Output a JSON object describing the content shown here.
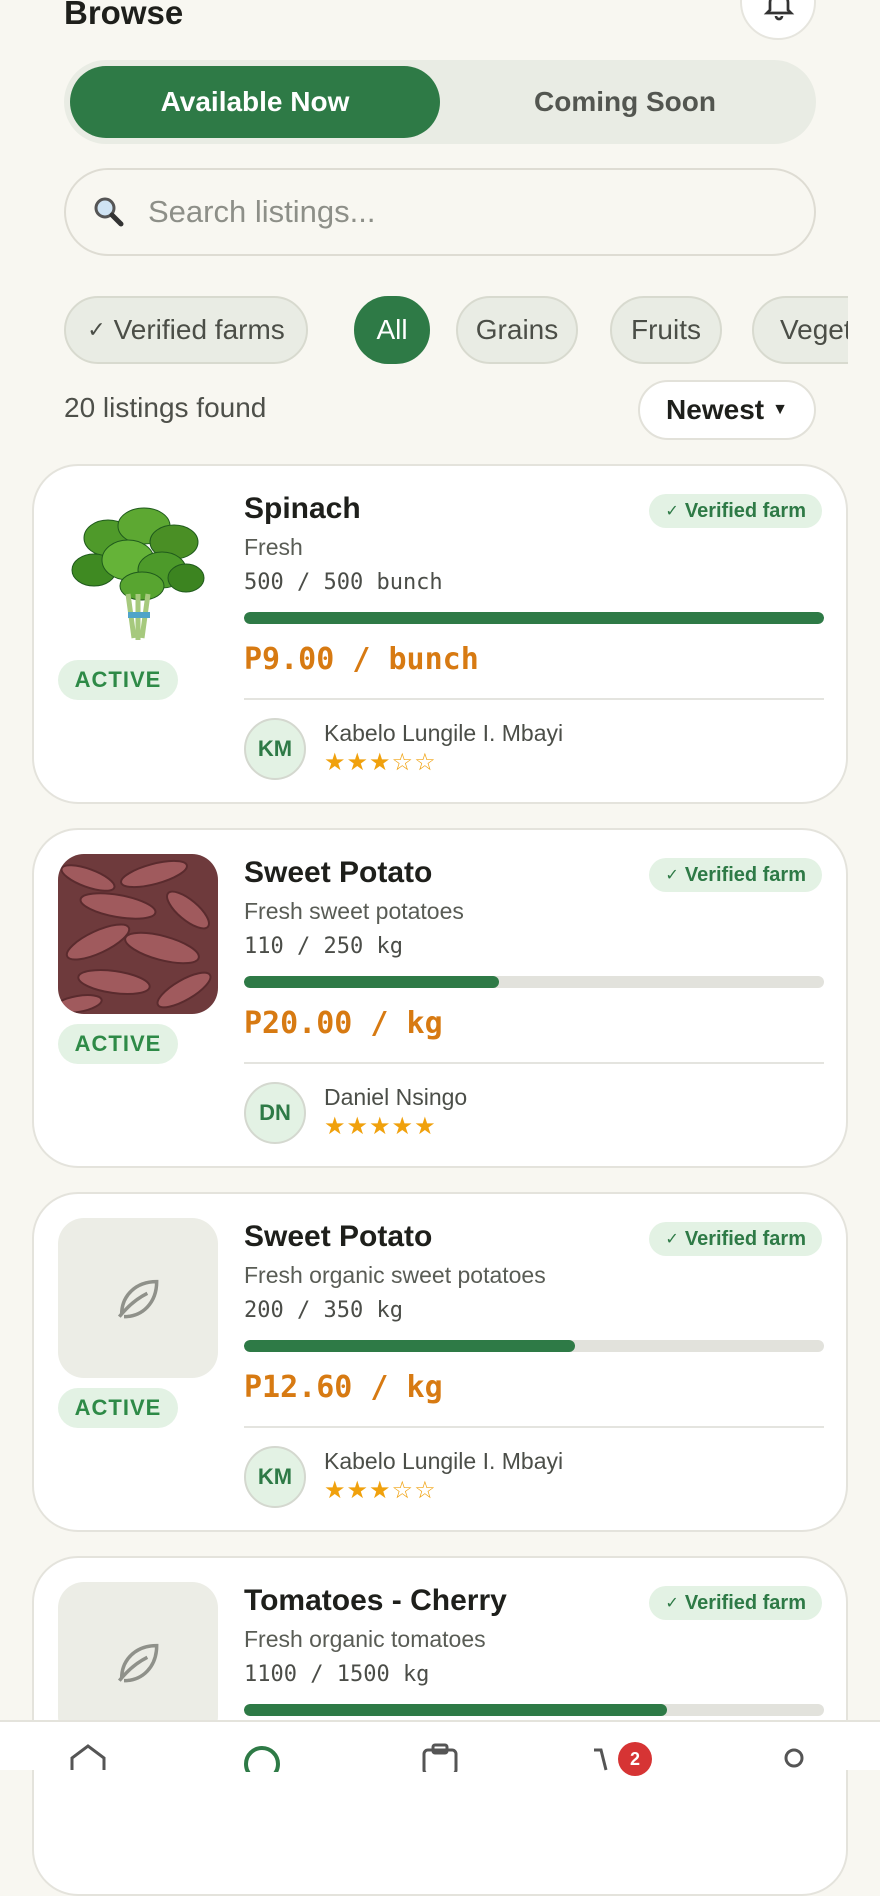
{
  "header": {
    "title": "Browse"
  },
  "segments": {
    "available": "Available Now",
    "coming": "Coming Soon"
  },
  "search": {
    "placeholder": "Search listings..."
  },
  "filters": [
    "Verified farms",
    "All",
    "Grains",
    "Fruits",
    "Vegetables"
  ],
  "results": {
    "count_text": "20 listings found",
    "sort_label": "Newest"
  },
  "colors": {
    "primary": "#2e7a46",
    "price": "#d77a12",
    "star": "#f0a10d",
    "badge_bg": "#e3f2e4",
    "alert": "#d63434"
  },
  "listings": [
    {
      "name": "Spinach",
      "desc": "Fresh",
      "qty": "500 / 500 bunch",
      "progress": 1.0,
      "price": "P9.00 / bunch",
      "status": "ACTIVE",
      "verified": "Verified farm",
      "initials": "KM",
      "farmer": "Kabelo Lungile I. Mbayi",
      "rating": 3,
      "image": "spinach"
    },
    {
      "name": "Sweet Potato",
      "desc": "Fresh sweet potatoes",
      "qty": "110 / 250 kg",
      "progress": 0.44,
      "price": "P20.00 / kg",
      "status": "ACTIVE",
      "verified": "Verified farm",
      "initials": "DN",
      "farmer": "Daniel Nsingo",
      "rating": 5,
      "image": "sweet-potato"
    },
    {
      "name": "Sweet Potato",
      "desc": "Fresh organic sweet potatoes",
      "qty": "200 / 350 kg",
      "progress": 0.57,
      "price": "P12.60 / kg",
      "status": "ACTIVE",
      "verified": "Verified farm",
      "initials": "KM",
      "farmer": "Kabelo Lungile I. Mbayi",
      "rating": 3,
      "image": "leaf-placeholder"
    },
    {
      "name": "Tomatoes - Cherry",
      "desc": "Fresh organic tomatoes",
      "qty": "1100 / 1500 kg",
      "progress": 0.73,
      "price": "",
      "status": "",
      "verified": "Verified farm",
      "initials": "",
      "farmer": "",
      "rating": 0,
      "image": "leaf-placeholder"
    }
  ],
  "tabbar": {
    "cart_count": "2",
    "icons": [
      "home-icon",
      "search-icon",
      "orders-icon",
      "cart-icon",
      "profile-icon"
    ]
  }
}
